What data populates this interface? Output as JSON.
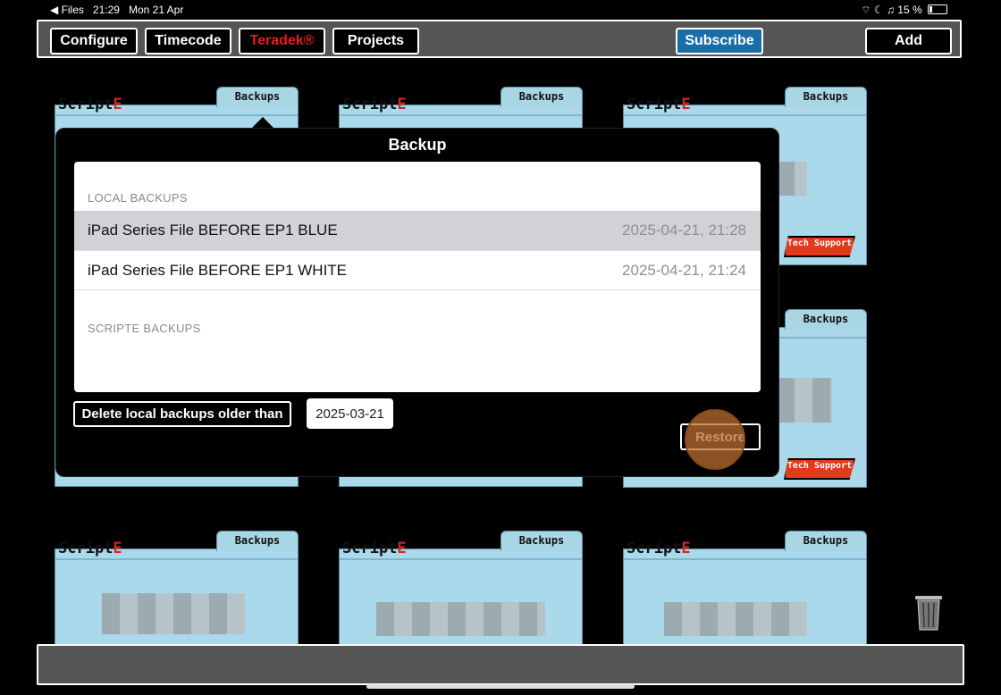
{
  "status_bar": {
    "back_app": "◀ Files",
    "time": "21:29",
    "date": "Mon 21 Apr",
    "battery": "15 %"
  },
  "toolbar": {
    "configure": "Configure",
    "timecode": "Timecode",
    "teradek": "Teradek®",
    "projects": "Projects",
    "subscribe": "Subscribe",
    "add": "Add"
  },
  "folder": {
    "logo_main": "Script",
    "logo_e": "E",
    "tab_label": "Backups",
    "tech_support": "Tech Support"
  },
  "backup_popover": {
    "title": "Backup",
    "local_section": "LOCAL BACKUPS",
    "scripte_section": "SCRIPTE BACKUPS",
    "local_backups": [
      {
        "name": "iPad Series File BEFORE EP1 BLUE",
        "date": "2025-04-21, 21:28",
        "selected": true
      },
      {
        "name": "iPad Series File BEFORE EP1 WHITE",
        "date": "2025-04-21, 21:24",
        "selected": false
      }
    ],
    "delete_label": "Delete local backups older than",
    "delete_date": "2025-03-21",
    "restore_label": "Restore"
  },
  "colors": {
    "accent_red": "#e51c1c",
    "subscribe_blue": "#1a6ea8",
    "folder_blue": "#a9d9ea",
    "touch_indicator": "#b86e32"
  }
}
